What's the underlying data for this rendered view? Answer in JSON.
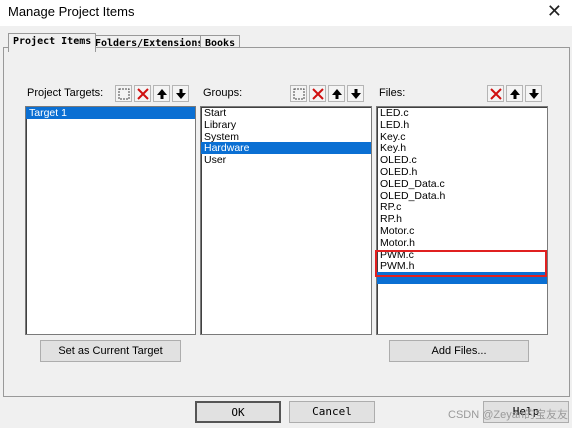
{
  "window": {
    "title": "Manage Project Items",
    "close_glyph": "✕"
  },
  "tabs": [
    {
      "label": "Project Items"
    },
    {
      "label": "Folders/Extensions"
    },
    {
      "label": "Books"
    }
  ],
  "targets": {
    "label": "Project Targets:",
    "items": [
      {
        "label": "Target 1",
        "selected": true
      }
    ],
    "set_current_button": "Set as Current Target"
  },
  "groups": {
    "label": "Groups:",
    "items": [
      {
        "label": "Start",
        "selected": false
      },
      {
        "label": "Library",
        "selected": false
      },
      {
        "label": "System",
        "selected": false
      },
      {
        "label": "Hardware",
        "selected": true
      },
      {
        "label": "User",
        "selected": false
      }
    ]
  },
  "files": {
    "label": "Files:",
    "items": [
      {
        "label": "LED.c",
        "selected": false
      },
      {
        "label": "LED.h",
        "selected": false
      },
      {
        "label": "Key.c",
        "selected": false
      },
      {
        "label": "Key.h",
        "selected": false
      },
      {
        "label": "OLED.c",
        "selected": false
      },
      {
        "label": "OLED.h",
        "selected": false
      },
      {
        "label": "OLED_Data.c",
        "selected": false
      },
      {
        "label": "OLED_Data.h",
        "selected": false
      },
      {
        "label": "RP.c",
        "selected": false
      },
      {
        "label": "RP.h",
        "selected": false
      },
      {
        "label": "Motor.c",
        "selected": false
      },
      {
        "label": "Motor.h",
        "selected": false
      },
      {
        "label": "PWM.c",
        "selected": false
      },
      {
        "label": "PWM.h",
        "selected": false
      },
      {
        "label": "",
        "selected": true
      }
    ],
    "add_files_button": "Add Files..."
  },
  "buttons": {
    "ok": "OK",
    "cancel": "Cancel",
    "help": "Help"
  },
  "watermark": "CSDN @Zeyan的宝友友",
  "colors": {
    "selection": "#0a6fd3",
    "highlight_box": "#e02020",
    "delete_icon": "#d01010"
  }
}
